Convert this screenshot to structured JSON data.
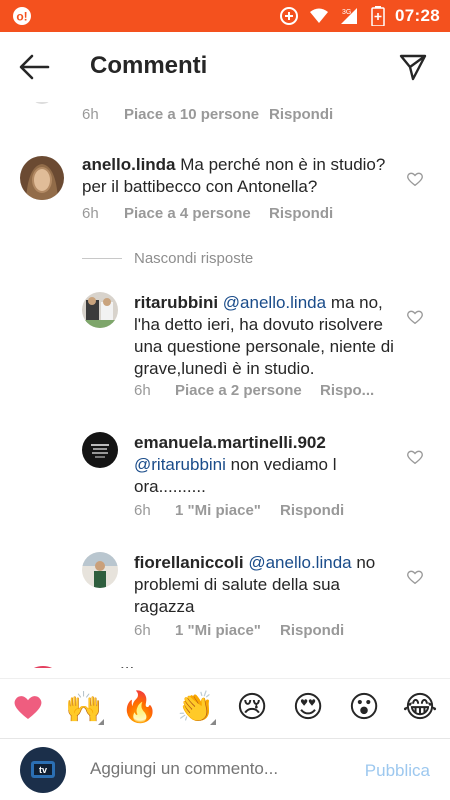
{
  "status_bar": {
    "time": "07:28",
    "icons": [
      "notification-icon",
      "data-saver-icon",
      "wifi-icon",
      "signal-3g-icon",
      "battery-icon"
    ],
    "network_label": "3G",
    "color": "#f4511e"
  },
  "header": {
    "title": "Commenti",
    "back_icon": "arrow-left-icon",
    "send_icon": "paper-plane-icon"
  },
  "top_meta": {
    "time": "6h",
    "likes": "Piace a 10 persone",
    "reply": "Rispondi"
  },
  "comments": [
    {
      "user": "anello.linda",
      "text": "Ma perché non è in studio? per il battibecco con Antonella?",
      "time": "6h",
      "likes": "Piace a 4 persone",
      "reply": "Rispondi"
    }
  ],
  "hide_replies": "Nascondi risposte",
  "replies": [
    {
      "user": "ritarubbini",
      "mention": "@anello.linda",
      "text": "ma no, l'ha detto ieri, ha dovuto risolvere una questione personale, niente di grave,lunedì è in studio.",
      "time": "6h",
      "likes": "Piace a 2 persone",
      "reply": "Rispo..."
    },
    {
      "user": "emanuela.martinelli.902",
      "mention": "@ritarubbini",
      "text": "non vediamo l ora..........",
      "time": "6h",
      "likes": "1 \"Mi piace\"",
      "reply": "Rispondi"
    },
    {
      "user": "fiorellaniccoli",
      "mention": "@anello.linda",
      "text": "no problemi di salute della sua ragazza",
      "time": "6h",
      "likes": "1 \"Mi piace\"",
      "reply": "Rispondi"
    }
  ],
  "partial_next": {
    "text": "..."
  },
  "emoji_bar": [
    {
      "name": "heart-emoji",
      "glyph": "❤"
    },
    {
      "name": "raised-hands-emoji",
      "glyph": "🙌"
    },
    {
      "name": "fire-emoji",
      "glyph": "🔥"
    },
    {
      "name": "clapping-hands-emoji",
      "glyph": "👏"
    },
    {
      "name": "sad-face-emoji",
      "glyph": "😢"
    },
    {
      "name": "heart-eyes-emoji",
      "glyph": "😍"
    },
    {
      "name": "surprised-face-emoji",
      "glyph": "😮"
    },
    {
      "name": "laughing-tears-emoji",
      "glyph": "😂"
    }
  ],
  "composer": {
    "placeholder": "Aggiungi un commento...",
    "publish": "Pubblica"
  }
}
